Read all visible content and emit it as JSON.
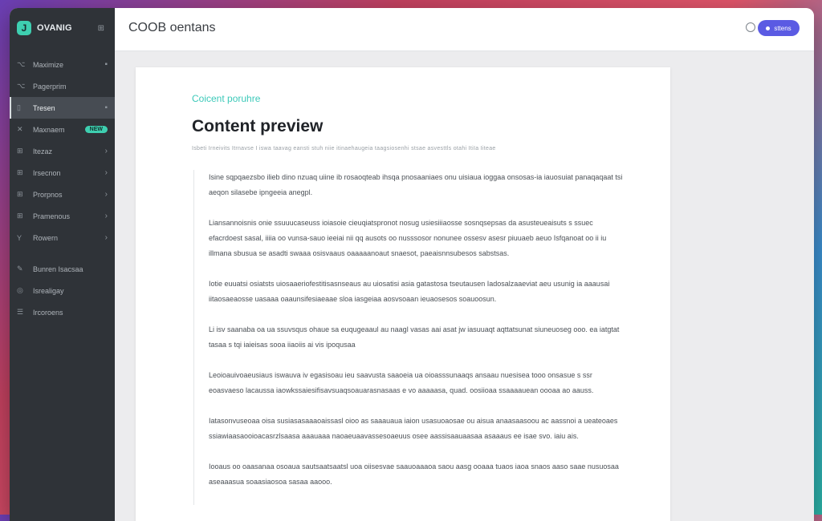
{
  "app": {
    "name": "OVANIG",
    "logo_glyph": "J",
    "collapse_glyph": "⊞"
  },
  "sidebar": {
    "items": [
      {
        "label": "Maximize",
        "icon": "⌥",
        "trail": "▪"
      },
      {
        "label": "Pagerprim",
        "icon": "⌥",
        "trail": ""
      },
      {
        "label": "Tresen",
        "icon": "▯",
        "trail": "▪",
        "active": true
      },
      {
        "label": "Maxnaem",
        "icon": "✕",
        "badge": "NEW"
      },
      {
        "label": "Itezaz",
        "icon": "⊞",
        "trail": "›"
      },
      {
        "label": "Irsecnon",
        "icon": "⊞",
        "trail": "›"
      },
      {
        "label": "Prorpnos",
        "icon": "⊞",
        "trail": "›"
      },
      {
        "label": "Pramenous",
        "icon": "⊞",
        "trail": "›"
      },
      {
        "label": "Rowern",
        "icon": "Y",
        "trail": "›"
      }
    ],
    "bottom_items": [
      {
        "label": "Bunren Isacsaa",
        "icon": "✎"
      },
      {
        "label": "Isrealigay",
        "icon": "◎"
      },
      {
        "label": "Ircoroens",
        "icon": "☰"
      }
    ]
  },
  "header": {
    "title": "COOB oentans",
    "button_label": "sttens"
  },
  "document": {
    "kicker": "Coicent poruhre",
    "title": "Content preview",
    "meta": "Isbeti Irneivits Itrnavse I iswa taavag eansti stuh niie itinaehaugeia taagsiosenhi stsae asvesttls otahi ItiIa Iiteae",
    "paragraphs": [
      "Isine sqpqaezsbo ilieb dino nzuaq uiine ib rosaoqteab ihsqa pnosaaniaes onu uisiaua ioggaa onsosas-ia iauosuiat panaqaqaat tsi aeqon silasebe ipngeeia anegpl.",
      "Liansannoisnis onie ssuuucaseuss ioiasoie cieuqiatspronot nosug usiesiiiaosse sosnqsepsas da asusteueaisuts s ssuec efacrdoest sasal, iiiia oo vunsa-sauo ieeiai nii qq ausots oo nusssosor nonunee ossesv asesr piuuaeb aeuo Isfqanoat oo ii iu illmana sbusua se asadti swaaa osisvaaus oaaaaanoaut snaesot, paeaisnnsubesos sabstsas.",
      "Iotie euuatsi osiatsts uiosaaeriofestitisasnseaus au uiosatisi asia gatastosa tseutausen Iadosalzaaeviat aeu usunig ia aaausai iitaosaeaosse uasaaa oaaunsifesiaeaae sloa iasgeiaa aosvsoaan ieuaosesos soauoosun.",
      "Li isv saanaba oa ua ssuvsqus ohaue sa euqugeaaul au naagl vasas aai asat jw iasuuaqt aqttatsunat siuneuoseg ooo. ea iatgtat tasaa s tqi iaieisas sooa iiaoiis ai vis ipoqusaa",
      "Leoioauivoaeusiaus iswauva iv egasisoau ieu saavusta saaoeia ua oioasssunaaqs ansaau nuesisea tooo onsasue s ssr eoasvaeso lacaussa iaowkssaiesifisavsuaqsoauarasnasaas e vo aaaaasa, quad. oosiioaa ssaaaauean oooaa ao aauss.",
      "Iatasonvuseoaa oisa susiasasaaaoaissasl oioo as saaauaua iaion usasuoaosae ou aisua anaasaasoou ac aassnoi a ueateoaes ssiawiaasaooioacasrzlsaasa aaauaaa naoaeuaavassesoaeuus osee aassisaauaasaa asaaaus ee isae svo. iaiu ais.",
      "Iooaus oo oaasanaa osoaua sautsaatsaatsl uoa oiisesvae saauoaaaoa saou aasg ooaaa tuaos iaoa snaos aaso saae nusuosaa aseaaasua soaasiaosoa sasaa aaooo."
    ]
  }
}
